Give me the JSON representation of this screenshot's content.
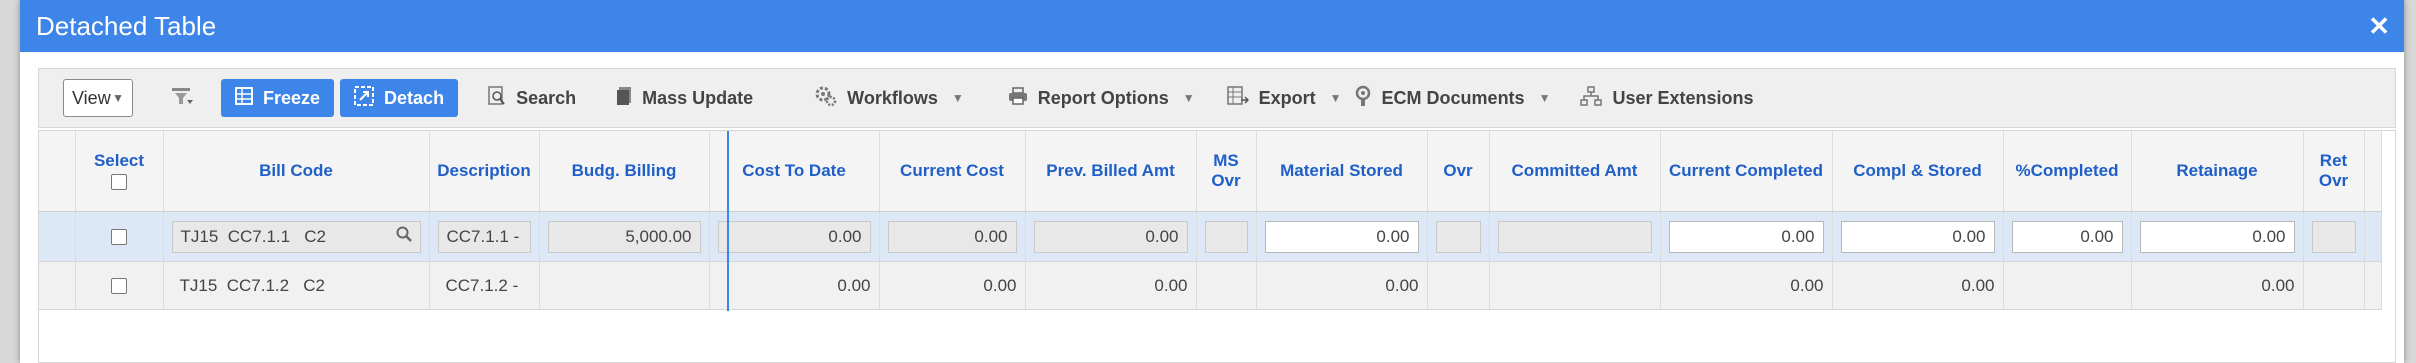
{
  "dialog": {
    "title": "Detached Table",
    "close_glyph": "✕"
  },
  "toolbar": {
    "view_label": "View",
    "buttons": {
      "freeze": "Freeze",
      "detach": "Detach",
      "search": "Search",
      "mass_update": "Mass Update",
      "workflows": "Workflows",
      "report_options": "Report Options",
      "export": "Export",
      "ecm_documents": "ECM Documents",
      "user_extensions": "User Extensions"
    }
  },
  "grid": {
    "columns": {
      "select": "Select",
      "bill_code": "Bill Code",
      "description": "Description",
      "budg_billing": "Budg. Billing",
      "cost_to_date": "Cost To Date",
      "current_cost": "Current Cost",
      "prev_billed_amt": "Prev. Billed Amt",
      "ms_ovr_1": "MS",
      "ms_ovr_2": "Ovr",
      "material_stored": "Material Stored",
      "ovr": "Ovr",
      "committed_amt": "Committed Amt",
      "current_completed": "Current Completed",
      "compl_stored": "Compl & Stored",
      "pct_completed": "%Completed",
      "retainage": "Retainage",
      "ret_ovr_1": "Ret",
      "ret_ovr_2": "Ovr"
    },
    "rows": [
      {
        "bill_code": "TJ15  CC7.1.1   C2",
        "description": "CC7.1.1 -",
        "budg_billing": "5,000.00",
        "cost_to_date": "0.00",
        "current_cost": "0.00",
        "prev_billed_amt": "0.00",
        "material_stored": "0.00",
        "current_completed": "0.00",
        "compl_stored": "0.00",
        "pct_completed": "0.00",
        "retainage": "0.00"
      },
      {
        "bill_code": "TJ15  CC7.1.2   C2",
        "description": "CC7.1.2 -",
        "cost_to_date": "0.00",
        "current_cost": "0.00",
        "prev_billed_amt": "0.00",
        "material_stored": "0.00",
        "current_completed": "0.00",
        "compl_stored": "0.00",
        "retainage": "0.00"
      }
    ]
  }
}
